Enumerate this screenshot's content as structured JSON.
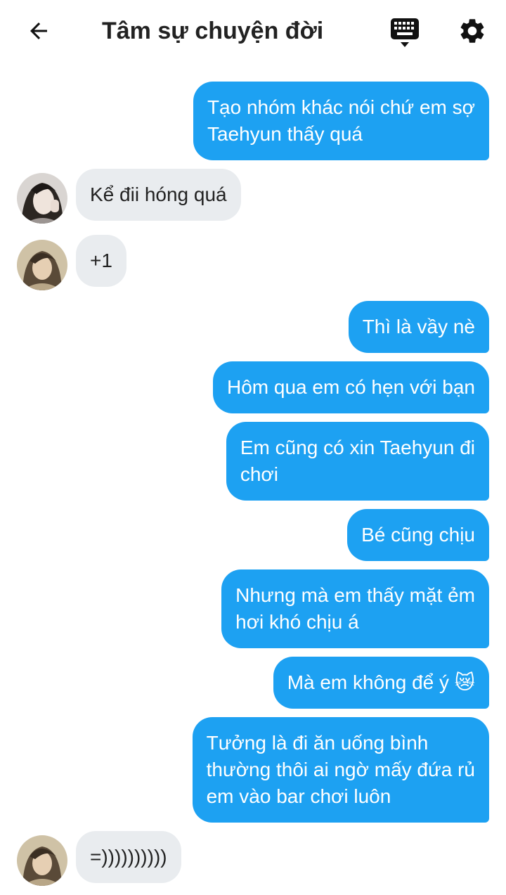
{
  "header": {
    "title": "Tâm sự chuyện đời",
    "back_icon": "arrow-left-icon",
    "keyboard_icon": "keyboard-icon",
    "settings_icon": "gear-icon"
  },
  "colors": {
    "outgoing_bubble": "#1da1f2",
    "incoming_bubble": "#e9ecef"
  },
  "messages": [
    {
      "dir": "out",
      "text": "Tạo nhóm khác nói chứ em sợ\nTaehyun thấy quá"
    },
    {
      "dir": "in",
      "text": "Kể đii hóng quá"
    },
    {
      "dir": "in",
      "text": "+1"
    },
    {
      "dir": "out",
      "text": "Thì là vầy nè"
    },
    {
      "dir": "out",
      "text": "Hôm qua em có hẹn với bạn"
    },
    {
      "dir": "out",
      "text": "Em cũng có xin Taehyun đi\nchơi"
    },
    {
      "dir": "out",
      "text": "Bé cũng chịu"
    },
    {
      "dir": "out",
      "text": "Nhưng mà em thấy mặt ẻm\nhơi khó chịu á"
    },
    {
      "dir": "out",
      "text": "Mà em không để ý 😿"
    },
    {
      "dir": "out",
      "text": "Tưởng là đi ăn uống bình\nthường thôi ai ngờ mấy đứa rủ\nem vào bar chơi luôn"
    },
    {
      "dir": "in",
      "text": "=))))))))))"
    }
  ]
}
